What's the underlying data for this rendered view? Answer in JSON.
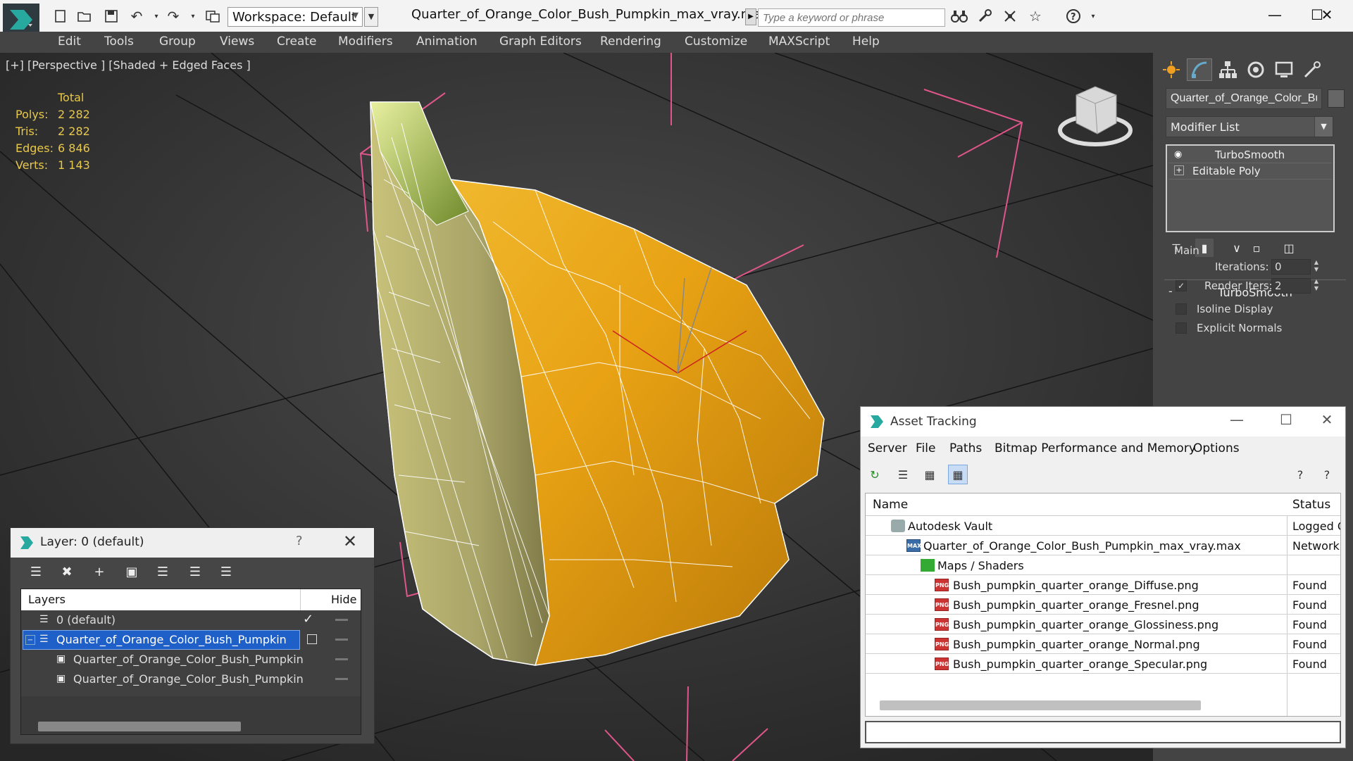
{
  "titlebar": {
    "workspace_label": "Workspace: Default",
    "file_title": "Quarter_of_Orange_Color_Bush_Pumpkin_max_vray.max",
    "search_placeholder": "Type a keyword or phrase"
  },
  "menu": [
    "Edit",
    "Tools",
    "Group",
    "Views",
    "Create",
    "Modifiers",
    "Animation",
    "Graph Editors",
    "Rendering",
    "Customize",
    "MAXScript",
    "Help"
  ],
  "viewport": {
    "label": "[+] [Perspective ] [Shaded + Edged Faces ]",
    "stats_header": "Total",
    "stats": [
      {
        "label": "Polys:",
        "value": "2 282"
      },
      {
        "label": "Tris:",
        "value": "2 282"
      },
      {
        "label": "Edges:",
        "value": "6 846"
      },
      {
        "label": "Verts:",
        "value": "1 143"
      }
    ]
  },
  "command_panel": {
    "object_name": "Quarter_of_Orange_Color_Bush",
    "modifier_list": "Modifier List",
    "stack": [
      "TurboSmooth",
      "Editable Poly"
    ],
    "rollout_title": "TurboSmooth",
    "group_main": "Main",
    "iterations_label": "Iterations:",
    "iterations_value": "0",
    "render_iters_label": "Render Iters:",
    "render_iters_value": "2",
    "isoline_label": "Isoline Display",
    "explicit_normals_label": "Explicit Normals"
  },
  "layer_dialog": {
    "title": "Layer: 0 (default)",
    "help": "?",
    "col_layers": "Layers",
    "col_hide": "Hide",
    "rows": [
      {
        "name": "0 (default)"
      },
      {
        "name": "Quarter_of_Orange_Color_Bush_Pumpkin"
      },
      {
        "name": "Quarter_of_Orange_Color_Bush_Pumpkin"
      },
      {
        "name": "Quarter_of_Orange_Color_Bush_Pumpkin"
      }
    ]
  },
  "asset_dialog": {
    "title": "Asset Tracking",
    "menu": [
      "Server",
      "File",
      "Paths",
      "Bitmap Performance and Memory",
      "Options"
    ],
    "col_name": "Name",
    "col_status": "Status",
    "rows": [
      {
        "name": "Autodesk Vault",
        "status": "Logged O"
      },
      {
        "name": "Quarter_of_Orange_Color_Bush_Pumpkin_max_vray.max",
        "status": "Network"
      },
      {
        "name": "Maps / Shaders",
        "status": ""
      },
      {
        "name": "Bush_pumpkin_quarter_orange_Diffuse.png",
        "status": "Found"
      },
      {
        "name": "Bush_pumpkin_quarter_orange_Fresnel.png",
        "status": "Found"
      },
      {
        "name": "Bush_pumpkin_quarter_orange_Glossiness.png",
        "status": "Found"
      },
      {
        "name": "Bush_pumpkin_quarter_orange_Normal.png",
        "status": "Found"
      },
      {
        "name": "Bush_pumpkin_quarter_orange_Specular.png",
        "status": "Found"
      }
    ]
  }
}
